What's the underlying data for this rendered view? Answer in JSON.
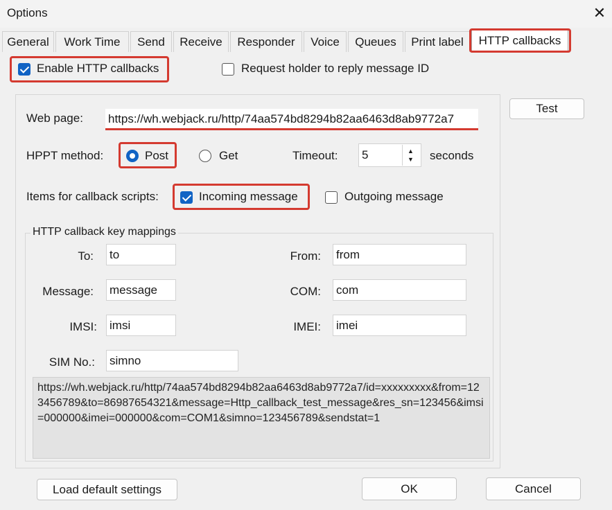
{
  "window": {
    "title": "Options",
    "close_glyph": "✕"
  },
  "tabs": [
    {
      "label": "General"
    },
    {
      "label": "Work Time"
    },
    {
      "label": "Send"
    },
    {
      "label": "Receive"
    },
    {
      "label": "Responder"
    },
    {
      "label": "Voice"
    },
    {
      "label": "Queues"
    },
    {
      "label": "Print label"
    },
    {
      "label": "HTTP callbacks"
    }
  ],
  "active_tab": "HTTP callbacks",
  "options": {
    "enable_http_callbacks": {
      "label": "Enable HTTP callbacks",
      "checked": true
    },
    "request_holder": {
      "label": "Request holder to reply message ID",
      "checked": false
    }
  },
  "web_page": {
    "label": "Web page:",
    "value": "https://wh.webjack.ru/http/74aa574bd8294b82aa6463d8ab9772a7",
    "test_label": "Test"
  },
  "method": {
    "label": "HPPT method:",
    "post_label": "Post",
    "get_label": "Get",
    "selected": "Post",
    "timeout_label": "Timeout:",
    "timeout_value": "5",
    "seconds_label": "seconds"
  },
  "items": {
    "label": "Items for callback scripts:",
    "incoming": {
      "label": "Incoming message",
      "checked": true
    },
    "outgoing": {
      "label": "Outgoing message",
      "checked": false
    }
  },
  "mappings": {
    "title": "HTTP callback key mappings",
    "to": {
      "label": "To:",
      "value": "to"
    },
    "from": {
      "label": "From:",
      "value": "from"
    },
    "message": {
      "label": "Message:",
      "value": "message"
    },
    "com": {
      "label": "COM:",
      "value": "com"
    },
    "imsi": {
      "label": "IMSI:",
      "value": "imsi"
    },
    "imei": {
      "label": "IMEI:",
      "value": "imei"
    },
    "simno": {
      "label": "SIM No.:",
      "value": "simno"
    }
  },
  "preview": "https://wh.webjack.ru/http/74aa574bd8294b82aa6463d8ab9772a7/id=xxxxxxxxx&from=123456789&to=86987654321&message=Http_callback_test_message&res_sn=123456&imsi=000000&imei=000000&com=COM1&simno=123456789&sendstat=1",
  "buttons": {
    "load_default": "Load default settings",
    "ok": "OK",
    "cancel": "Cancel"
  },
  "colors": {
    "accent": "#1163c4",
    "highlight": "#d43a30"
  }
}
